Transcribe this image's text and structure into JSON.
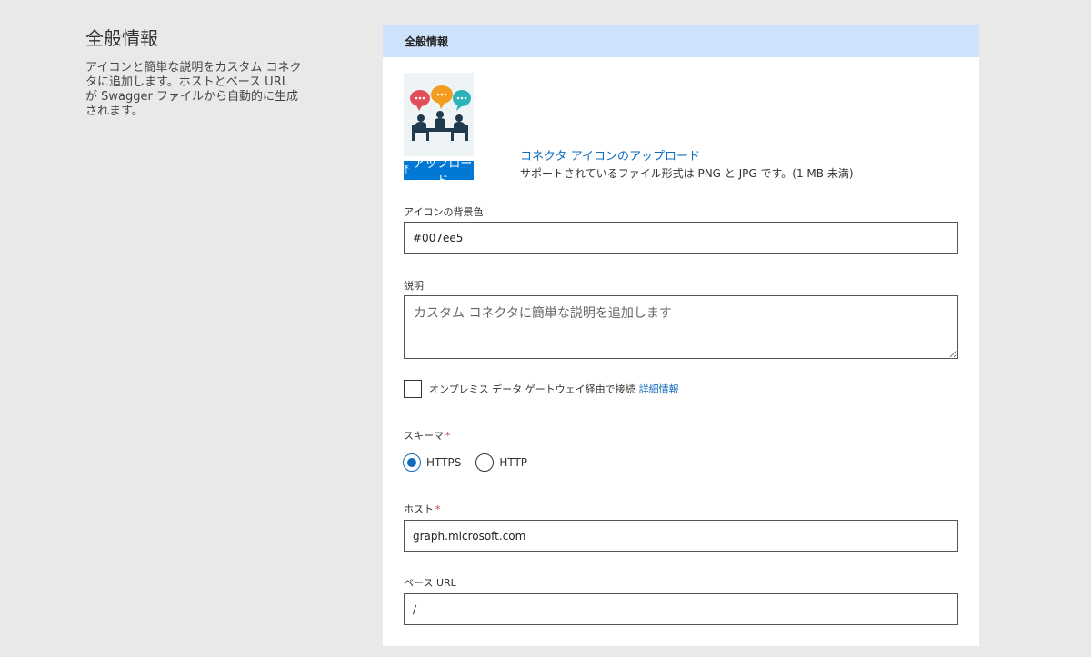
{
  "left": {
    "title": "全般情報",
    "description": "アイコンと簡単な説明をカスタム コネクタに追加します。ホストとベース URL が Swagger ファイルから自動的に生成されます。"
  },
  "card": {
    "header": "全般情報",
    "upload_button": "アップロード",
    "upload_link": "コネクタ アイコンのアップロード",
    "upload_note": "サポートされているファイル形式は PNG と JPG です。(1 MB 未満)",
    "icon_bg_label": "アイコンの背景色",
    "icon_bg_value": "#007ee5",
    "description_label": "説明",
    "description_placeholder": "カスタム コネクタに簡単な説明を追加します",
    "gateway_label": "オンプレミス データ ゲートウェイ経由で接続",
    "gateway_link": "詳細情報",
    "gateway_checked": false,
    "scheme_label": "スキーマ",
    "scheme_options": [
      "HTTPS",
      "HTTP"
    ],
    "scheme_selected": "HTTPS",
    "host_label": "ホスト",
    "host_value": "graph.microsoft.com",
    "base_url_label": "ベース URL",
    "base_url_value": "/",
    "required_mark": "*"
  },
  "colors": {
    "header_bg": "#cfe2fb",
    "accent": "#0078d4",
    "link": "#0f6cbd",
    "required": "#d13438"
  },
  "icons": {
    "upload": "upload-arrow-icon",
    "connector": "meeting-chat-icon"
  }
}
